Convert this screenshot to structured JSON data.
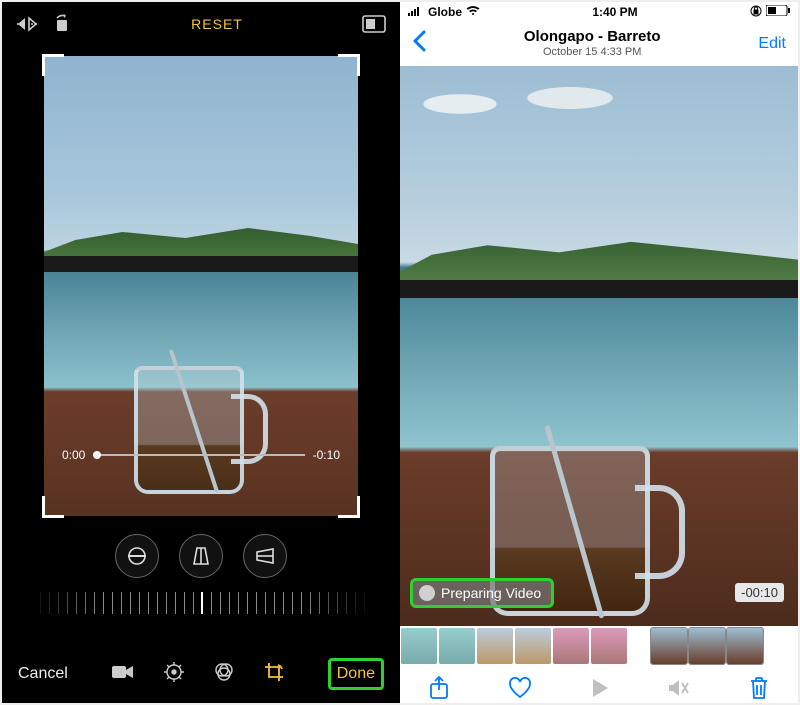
{
  "left": {
    "reset_label": "RESET",
    "scrubber": {
      "start": "0:00",
      "end": "-0:10"
    },
    "cancel_label": "Cancel",
    "done_label": "Done"
  },
  "right": {
    "status": {
      "carrier": "Globe",
      "time": "1:40 PM"
    },
    "nav": {
      "title": "Olongapo - Barreto",
      "subtitle": "October 15  4:33 PM",
      "edit": "Edit"
    },
    "preparing_label": "Preparing Video",
    "remaining_label": "-00:10"
  }
}
